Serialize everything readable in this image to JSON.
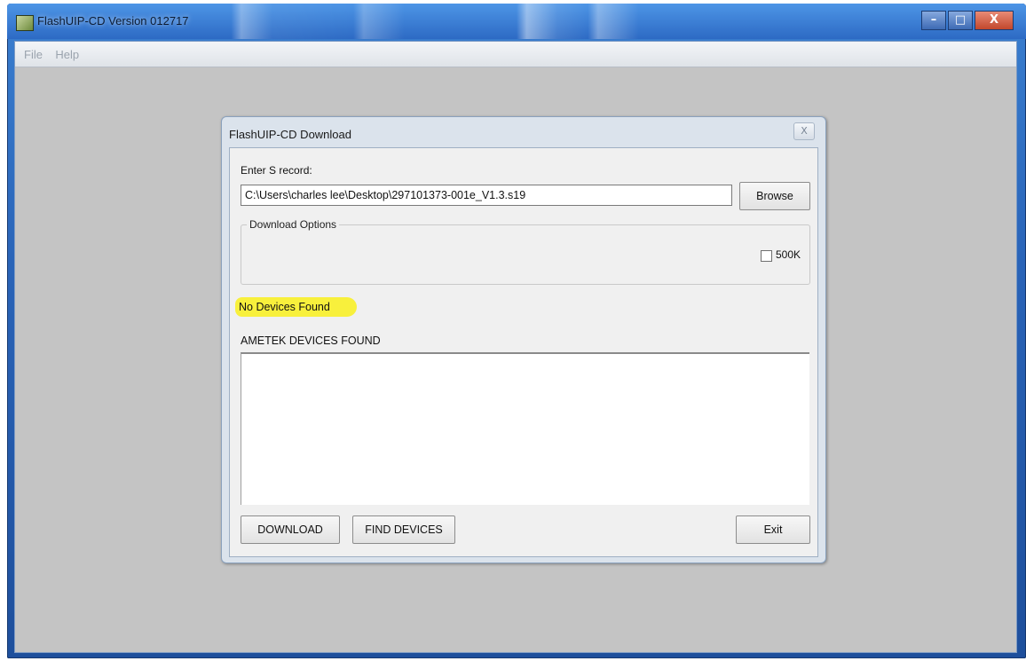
{
  "window": {
    "title": "FlashUIP-CD Version 012717",
    "minimize_glyph": "–",
    "maximize_glyph": "□",
    "close_glyph": "X"
  },
  "menubar": {
    "items": [
      "File",
      "Help"
    ]
  },
  "dialog": {
    "title": "FlashUIP-CD Download",
    "close_glyph": "X",
    "srecord_label": "Enter S record:",
    "srecord_value": "C:\\Users\\charles lee\\Desktop\\297101373-001e_V1.3.s19",
    "browse_label": "Browse",
    "options_group_label": "Download Options",
    "option_500k_label": "500K",
    "option_500k_checked": false,
    "status_text": "No Devices Found",
    "status_highlight_color": "#f8f03c",
    "devices_label": "AMETEK DEVICES FOUND",
    "devices": [],
    "download_label": "DOWNLOAD",
    "find_devices_label": "FIND DEVICES",
    "exit_label": "Exit"
  }
}
